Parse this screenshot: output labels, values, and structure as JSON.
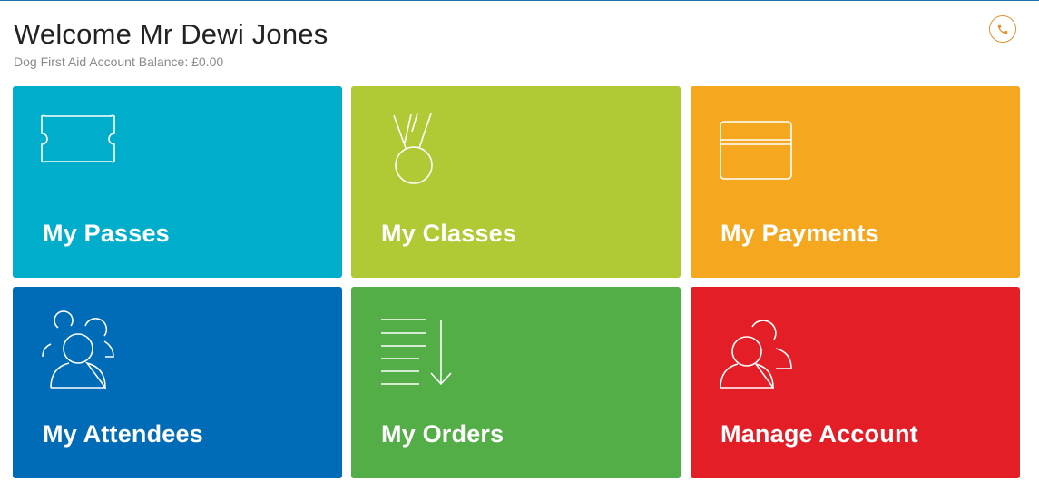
{
  "header": {
    "welcome": "Welcome Mr Dewi Jones",
    "balance": "Dog First Aid Account Balance: £0.00"
  },
  "contact": {
    "icon": "phone-icon",
    "color": "#e0922f"
  },
  "tiles": [
    {
      "label": "My Passes",
      "icon": "ticket-icon",
      "color": "#00aecb"
    },
    {
      "label": "My Classes",
      "icon": "medal-icon",
      "color": "#b0ca36"
    },
    {
      "label": "My Payments",
      "icon": "credit-card-icon",
      "color": "#f5a71f"
    },
    {
      "label": "My Attendees",
      "icon": "group-users-icon",
      "color": "#006bb6"
    },
    {
      "label": "My Orders",
      "icon": "list-download-icon",
      "color": "#53ae47"
    },
    {
      "label": "Manage Account",
      "icon": "users-icon",
      "color": "#e31e26"
    }
  ]
}
